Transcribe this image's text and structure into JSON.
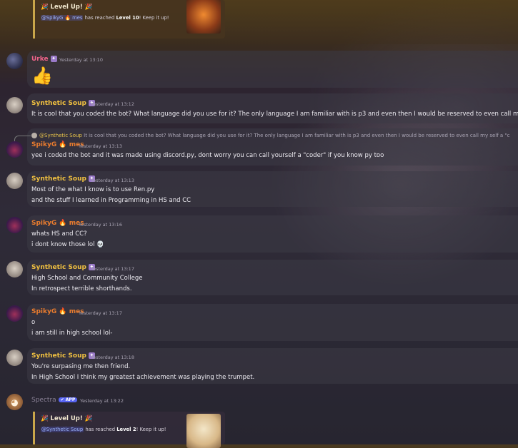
{
  "top_embed": {
    "title": "🎉 Level Up! 🎉",
    "user_mention": "@SpikyG 🔥 mes",
    "text_mid": " has reached ",
    "level": "Level 10",
    "text_end": "! Keep it up!"
  },
  "messages": [
    {
      "author": "Urke",
      "badge": "mod",
      "timestamp": "Yesterday at 13:10",
      "lines": [
        "👍"
      ]
    },
    {
      "author": "Synthetic Soup",
      "badge": "mod",
      "timestamp": "Yesterday at 13:12",
      "lines": [
        "It is cool that you coded the bot? What language did you use for it? The only language I am familiar with is p3 and even then I would be reserved to even call my self a"
      ]
    },
    {
      "author": "SpikyG 🔥 mes",
      "timestamp": "Yesterday at 13:13",
      "reply_to": "@Synthetic Soup",
      "reply_text": "It is cool that you coded the bot? What language did you use for it? The only language I am familiar with is p3 and even then I would be reserved to even call my self a \"c",
      "lines": [
        "yee i coded the bot and it was made using discord.py, dont worry you can call yourself a \"coder\" if you know py too"
      ]
    },
    {
      "author": "Synthetic Soup",
      "badge": "mod",
      "timestamp": "Yesterday at 13:13",
      "lines": [
        "Most of the what I know is to use Ren.py",
        "and the stuff I learned in Programming in HS and CC"
      ]
    },
    {
      "author": "SpikyG 🔥 mes",
      "timestamp": "Yesterday at 13:16",
      "lines": [
        "whats HS and CC?",
        "i dont know those lol 💀"
      ]
    },
    {
      "author": "Synthetic Soup",
      "badge": "mod",
      "timestamp": "Yesterday at 13:17",
      "lines": [
        "High School and Community College",
        "In retrospect terrible shorthands."
      ]
    },
    {
      "author": "SpikyG 🔥 mes",
      "timestamp": "Yesterday at 13:17",
      "lines": [
        "o",
        "i am still in high school lol-"
      ]
    },
    {
      "author": "Synthetic Soup",
      "badge": "mod",
      "timestamp": "Yesterday at 13:18",
      "lines": [
        "You're surpasing me then friend.",
        "In High School I think my greatest achievement was playing the trumpet."
      ]
    },
    {
      "author": "Spectra",
      "app_badge": "✔ APP",
      "timestamp": "Yesterday at 13:22"
    }
  ],
  "bottom_embed": {
    "title": "🎉 Level Up! 🎉",
    "user_mention": "@Synthetic Soup",
    "text_mid": " has reached ",
    "level": "Level 2",
    "text_end": "! Keep it up!"
  }
}
